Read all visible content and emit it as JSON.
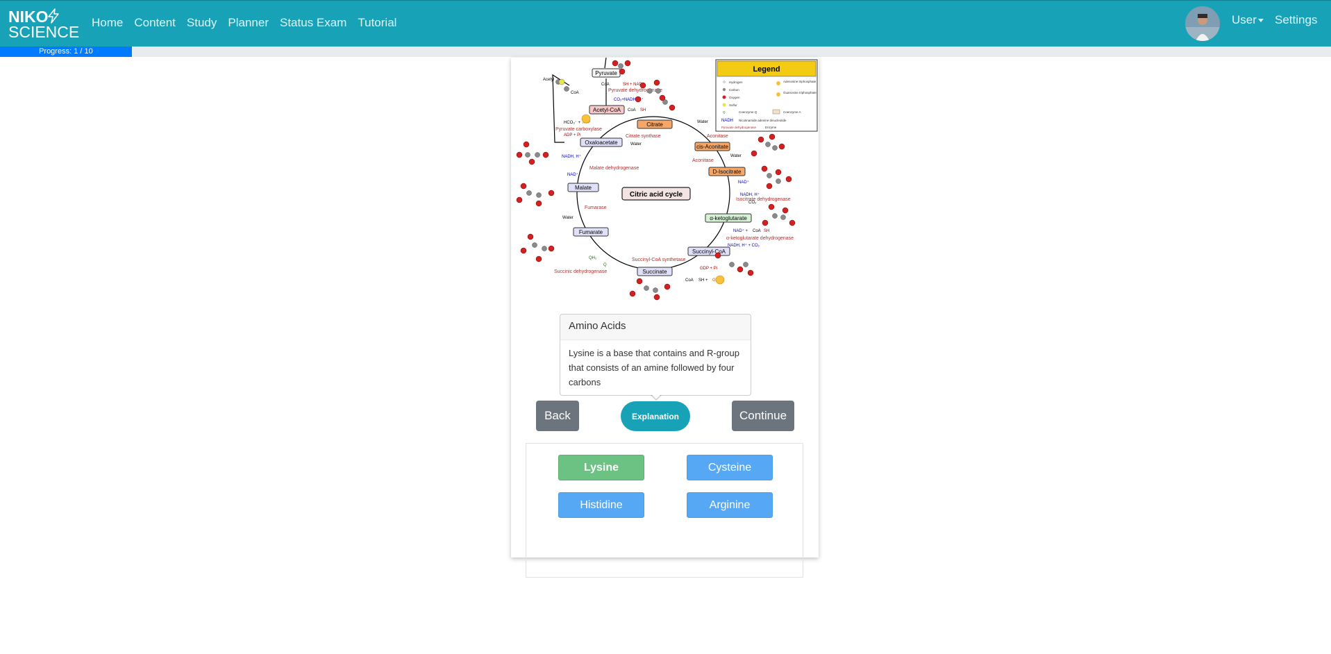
{
  "brand": {
    "line1": "NIKO",
    "line2": "SCIENCE"
  },
  "nav": {
    "home": "Home",
    "content": "Content",
    "study": "Study",
    "planner": "Planner",
    "status_exam": "Status Exam",
    "tutorial": "Tutorial"
  },
  "user_menu": {
    "label": "User",
    "settings": "Settings"
  },
  "progress": {
    "label": "Progress: 1 / 10",
    "fraction": 0.1
  },
  "diagram": {
    "center_label": "Citric acid cycle",
    "legend_title": "Legend",
    "legend_items": [
      "Hydrogen",
      "Carbon",
      "Oxygen",
      "Sulfur",
      "Q",
      "NADH",
      "Pyruvate dehydrogenase",
      "Adenosine triphosphate",
      "Guanosine triphosphate",
      "Coenzyme Q",
      "Coenzyme A",
      "Nicotinamide adenine dinucleotide",
      "Enzyme"
    ],
    "metabolites": [
      "Pyruvate",
      "Acetyl-CoA",
      "Citrate",
      "cis-Aconitate",
      "D-Isocitrate",
      "α-ketoglutarate",
      "Succinyl-CoA",
      "Succinate",
      "Fumarate",
      "Malate",
      "Oxaloacetate"
    ],
    "enzymes": [
      "Pyruvate dehydrogenase",
      "Citrate synthase",
      "Aconitase",
      "Aconitase",
      "Isocitrate dehydrogenase",
      "α-ketoglutarate dehydrogenase",
      "Succinyl-CoA synthetase",
      "Succinic dehydrogenase",
      "Fumarase",
      "Malate dehydrogenase",
      "Pyruvate carboxylase"
    ],
    "small_labels": [
      "CoA",
      "SH + NAD⁺",
      "CO₂+NADH, H⁺",
      "CoA",
      "SH",
      "Water",
      "Water",
      "Water",
      "NAD⁺",
      "NADH, H⁺",
      "CO₂",
      "NAD⁺ +",
      "CoA",
      "SH",
      "NADH, H⁺ + CO₂",
      "GDP + Pi",
      "CoA",
      "SH +",
      "GTP",
      "QH₂",
      "Q",
      "Water",
      "NAD⁺",
      "NADH, H⁺",
      "HCO₃⁻ +",
      "ATP",
      "ADP + Pi",
      "Acetyl",
      "CoA"
    ]
  },
  "popover": {
    "title": "Amino Acids",
    "body": "Lysine is a base that contains and R-group that consists of an amine followed by four carbons"
  },
  "buttons": {
    "back": "Back",
    "explanation": "Explanation",
    "continue": "Continue"
  },
  "answers": [
    "Lysine",
    "Cysteine",
    "Histidine",
    "Arginine"
  ],
  "colors": {
    "navbar": "#17a2b8",
    "progress": "#007bff",
    "correct": "#6cc283",
    "option": "#56a8f5",
    "secondary": "#6c757d"
  }
}
